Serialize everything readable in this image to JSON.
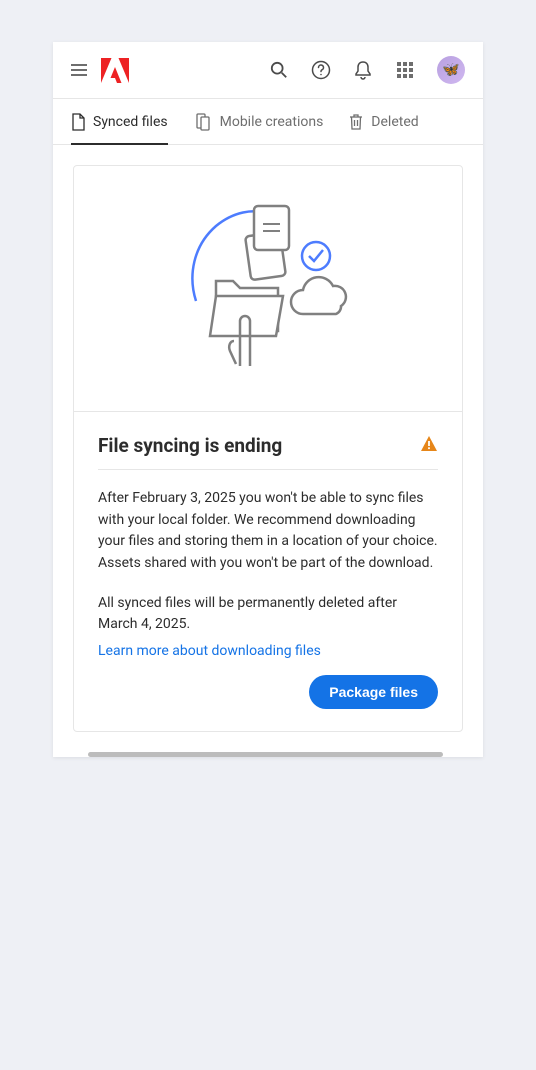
{
  "tabs": {
    "synced_files": "Synced files",
    "mobile_creations": "Mobile creations",
    "deleted": "Deleted"
  },
  "card": {
    "title": "File syncing is ending",
    "paragraph1": "After February 3, 2025 you won't be able to sync files with your local folder. We recommend downloading your files and storing them in a location of your choice. Assets shared with you won't be part of the download.",
    "paragraph2": "All synced files will be permanently deleted after March 4, 2025.",
    "link": "Learn more about downloading files",
    "button": "Package files"
  }
}
